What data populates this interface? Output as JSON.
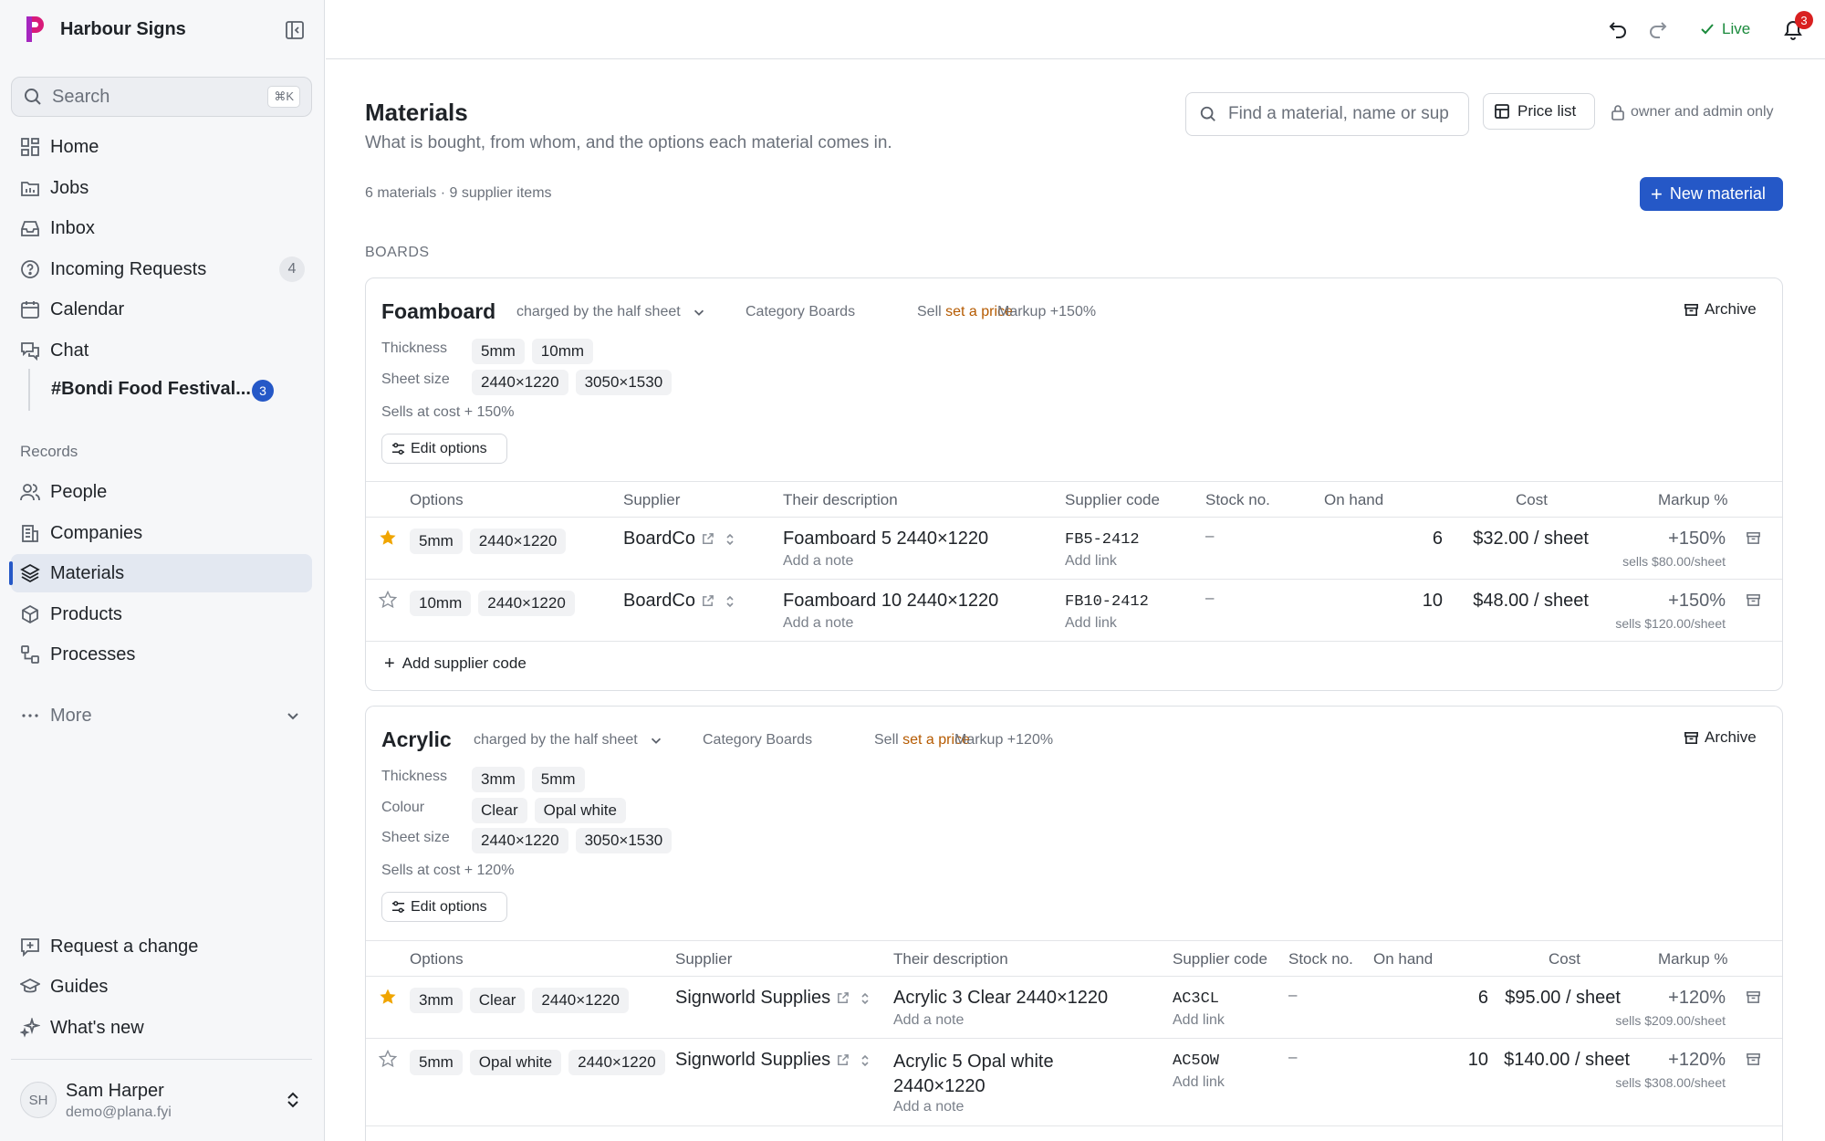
{
  "app": {
    "name": "Harbour Signs",
    "logo_color": "#c41e8e"
  },
  "sidebar": {
    "search_placeholder": "Search",
    "search_shortcut": "⌘K",
    "nav": [
      {
        "label": "Home",
        "icon": "grid-icon"
      },
      {
        "label": "Jobs",
        "icon": "folder-icon"
      },
      {
        "label": "Inbox",
        "icon": "inbox-icon"
      },
      {
        "label": "Incoming Requests",
        "icon": "question-circle-icon",
        "badge": "4"
      },
      {
        "label": "Calendar",
        "icon": "calendar-icon"
      },
      {
        "label": "Chat",
        "icon": "chat-icon"
      }
    ],
    "chat_channel": {
      "label": "#Bondi Food Festival...",
      "badge": "3"
    },
    "records_heading": "Records",
    "records": [
      {
        "label": "People",
        "icon": "people-icon"
      },
      {
        "label": "Companies",
        "icon": "building-icon"
      },
      {
        "label": "Materials",
        "icon": "layers-icon",
        "active": true
      },
      {
        "label": "Products",
        "icon": "cube-icon"
      },
      {
        "label": "Processes",
        "icon": "process-icon"
      }
    ],
    "more_label": "More",
    "footer": [
      {
        "label": "Request a change",
        "icon": "message-plus-icon"
      },
      {
        "label": "Guides",
        "icon": "graduation-cap-icon"
      },
      {
        "label": "What's new",
        "icon": "sparkles-icon"
      }
    ],
    "user": {
      "initials": "SH",
      "name": "Sam Harper",
      "email": "demo@plana.fyi"
    }
  },
  "topbar": {
    "live_label": "Live",
    "notifications_count": "3",
    "accent": "#1a8a3c"
  },
  "page": {
    "title": "Materials",
    "subtitle": "What is bought, from whom, and the options each material comes in.",
    "search_placeholder": "Find a material, name or sup",
    "price_list_label": "Price list",
    "owner_note": "owner and admin only",
    "summary": "6 materials · 9 supplier items",
    "new_button": "New material",
    "section_label": "BOARDS"
  },
  "table_headers": {
    "options": "Options",
    "supplier": "Supplier",
    "description": "Their description",
    "supplier_code": "Supplier code",
    "stock_no": "Stock no.",
    "on_hand": "On hand",
    "cost": "Cost",
    "markup": "Markup %"
  },
  "materials": [
    {
      "name": "Foamboard",
      "charged_by": "charged by the half sheet",
      "category_label": "Category",
      "category": "Boards",
      "sell_label": "Sell",
      "sell_value": "set a price",
      "markup_label": "Markup +150%",
      "archive_label": "Archive",
      "option_groups": [
        {
          "label": "Thickness",
          "values": [
            "5mm",
            "10mm"
          ]
        },
        {
          "label": "Sheet size",
          "values": [
            "2440×1220",
            "3050×1530"
          ]
        }
      ],
      "sells_at": "Sells at cost + 150%",
      "edit_options_label": "Edit options",
      "items": [
        {
          "starred": true,
          "options": [
            "5mm",
            "2440×1220"
          ],
          "supplier": "BoardCo",
          "description": "Foamboard 5 2440×1220",
          "note": "Add a note",
          "code": "FB5-2412",
          "link": "Add link",
          "stock": "–",
          "on_hand": "6",
          "cost": "$32.00 / sheet",
          "markup": "+150%",
          "sells": "sells $80.00/sheet"
        },
        {
          "starred": false,
          "options": [
            "10mm",
            "2440×1220"
          ],
          "supplier": "BoardCo",
          "description": "Foamboard 10 2440×1220",
          "note": "Add a note",
          "code": "FB10-2412",
          "link": "Add link",
          "stock": "–",
          "on_hand": "10",
          "cost": "$48.00 / sheet",
          "markup": "+150%",
          "sells": "sells $120.00/sheet"
        }
      ],
      "add_code_label": "Add supplier code"
    },
    {
      "name": "Acrylic",
      "charged_by": "charged by the half sheet",
      "category_label": "Category",
      "category": "Boards",
      "sell_label": "Sell",
      "sell_value": "set a price",
      "markup_label": "Markup +120%",
      "archive_label": "Archive",
      "option_groups": [
        {
          "label": "Thickness",
          "values": [
            "3mm",
            "5mm"
          ]
        },
        {
          "label": "Colour",
          "values": [
            "Clear",
            "Opal white"
          ]
        },
        {
          "label": "Sheet size",
          "values": [
            "2440×1220",
            "3050×1530"
          ]
        }
      ],
      "sells_at": "Sells at cost + 120%",
      "edit_options_label": "Edit options",
      "items": [
        {
          "starred": true,
          "options": [
            "3mm",
            "Clear",
            "2440×1220"
          ],
          "supplier": "Signworld Supplies",
          "description": "Acrylic 3 Clear 2440×1220",
          "note": "Add a note",
          "code": "AC3CL",
          "link": "Add link",
          "stock": "–",
          "on_hand": "6",
          "cost": "$95.00 / sheet",
          "markup": "+120%",
          "sells": "sells $209.00/sheet"
        },
        {
          "starred": false,
          "options": [
            "5mm",
            "Opal white",
            "2440×1220"
          ],
          "supplier": "Signworld Supplies",
          "description": "Acrylic 5 Opal white 2440×1220",
          "note": "Add a note",
          "code": "AC5OW",
          "link": "Add link",
          "stock": "–",
          "on_hand": "10",
          "cost": "$140.00 / sheet",
          "markup": "+120%",
          "sells": "sells $308.00/sheet"
        }
      ]
    }
  ]
}
